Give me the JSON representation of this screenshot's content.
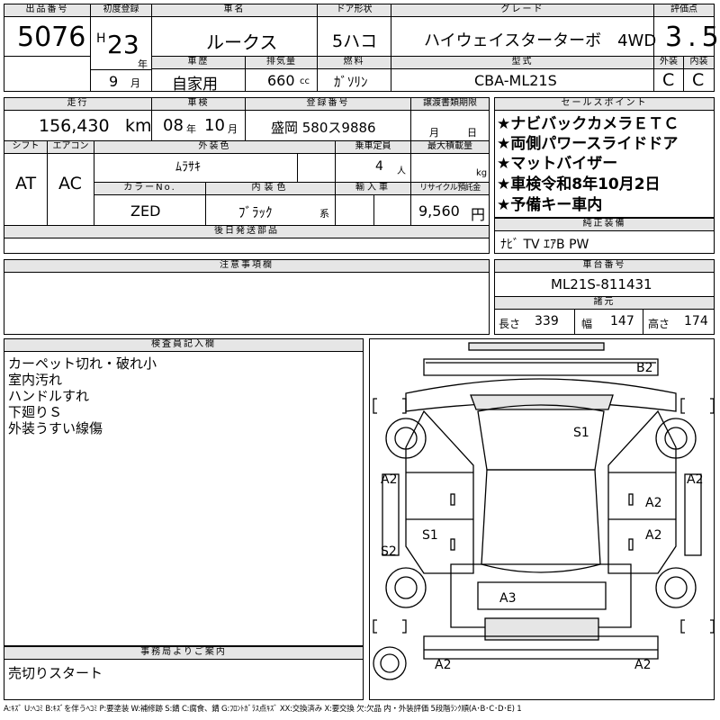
{
  "header": {
    "lot_no_label": "出品番号",
    "lot_no": "5076",
    "first_reg_label": "初度登録",
    "era": "H",
    "year": "23",
    "year_unit": "年",
    "month": "9",
    "month_unit": "月",
    "name_label": "車名",
    "name": "ルークス",
    "door_label": "ドア形状",
    "door": "5ハコ",
    "grade_label": "グレード",
    "grade": "ハイウェイスターターボ　4WD",
    "score_label": "評価点",
    "score": "3.5",
    "history_label": "車歴",
    "history": "自家用",
    "disp_label": "排気量",
    "disp": "660",
    "disp_unit": "cc",
    "fuel_label": "燃料",
    "fuel": "ｶﾞｿﾘﾝ",
    "model_label": "型式",
    "model": "CBA-ML21S",
    "ext_label": "外装",
    "ext": "C",
    "int_label": "内装",
    "int": "C"
  },
  "row2": {
    "mileage_label": "走行",
    "mileage": "156,430",
    "mileage_unit": "km",
    "inspect_label": "車検",
    "inspect_y": "08",
    "inspect_y_unit": "年",
    "inspect_m": "10",
    "inspect_m_unit": "月",
    "plate_label": "登録番号",
    "plate": "盛岡 580ス9886",
    "transfer_label": "譲渡書類期限",
    "transfer_m_unit": "月",
    "transfer_d_unit": "日",
    "shift_label": "シフト",
    "shift": "AT",
    "ac_label": "エアコン",
    "ac": "AC",
    "color_label": "外装色",
    "color": "ﾑﾗｻｷ",
    "cap_label": "乗車定員",
    "cap": "4",
    "cap_unit": "人",
    "load_label": "最大積載量",
    "load_unit": "kg",
    "color_no_label": "カラーNo.",
    "color_no": "ZED",
    "int_color_label": "内装色",
    "int_color": "ﾌﾞﾗｯｸ",
    "int_color_unit": "系",
    "import_label": "輸入車",
    "recycle_label": "リサイクル預託金",
    "recycle": "9,560",
    "recycle_unit": "円",
    "later_label": "後日発送部品"
  },
  "sales": {
    "label": "セールスポイント",
    "items": [
      "★ナビバックカメラＥＴＣ",
      "★両側パワースライドドア",
      "★マットバイザー",
      "★車検令和8年10月2日",
      "★予備キー車内"
    ]
  },
  "equip": {
    "label": "純正装備",
    "value": "ﾅﾋﾞ TV ｴｱB PW"
  },
  "notes": {
    "label": "注意事項欄"
  },
  "chassis": {
    "label": "車台番号",
    "value": "ML21S-811431",
    "dims_label": "諸元",
    "len_label": "長さ",
    "len": "339",
    "wid_label": "幅",
    "wid": "147",
    "hei_label": "高さ",
    "hei": "174"
  },
  "inspector": {
    "label": "検査員記入欄",
    "lines": [
      "カーペット切れ・破れ小",
      "室内汚れ",
      "ハンドルすれ",
      "下廻りＳ",
      "外装うすい線傷"
    ]
  },
  "office": {
    "label": "事務局よりご案内",
    "text": "売切りスタート"
  },
  "damage": [
    "B2",
    "S1",
    "A2",
    "A2",
    "A2",
    "A2",
    "S1",
    "A2",
    "S2",
    "A3",
    "A2",
    "A2"
  ],
  "legend": "A:ｷｽﾞ U:ﾍｺﾐ B:ｷｽﾞを伴うﾍｺﾐ P:要塗装 W:補修跡 S:錆 C:腐食、錆 G:ﾌﾛﾝﾄｶﾞﾗｽ点ｷｽﾞ XX:交換済み X:要交換 欠:欠品 内・外装評価 5段階ﾗﾝｸ順(A･B･C･D･E) 1"
}
